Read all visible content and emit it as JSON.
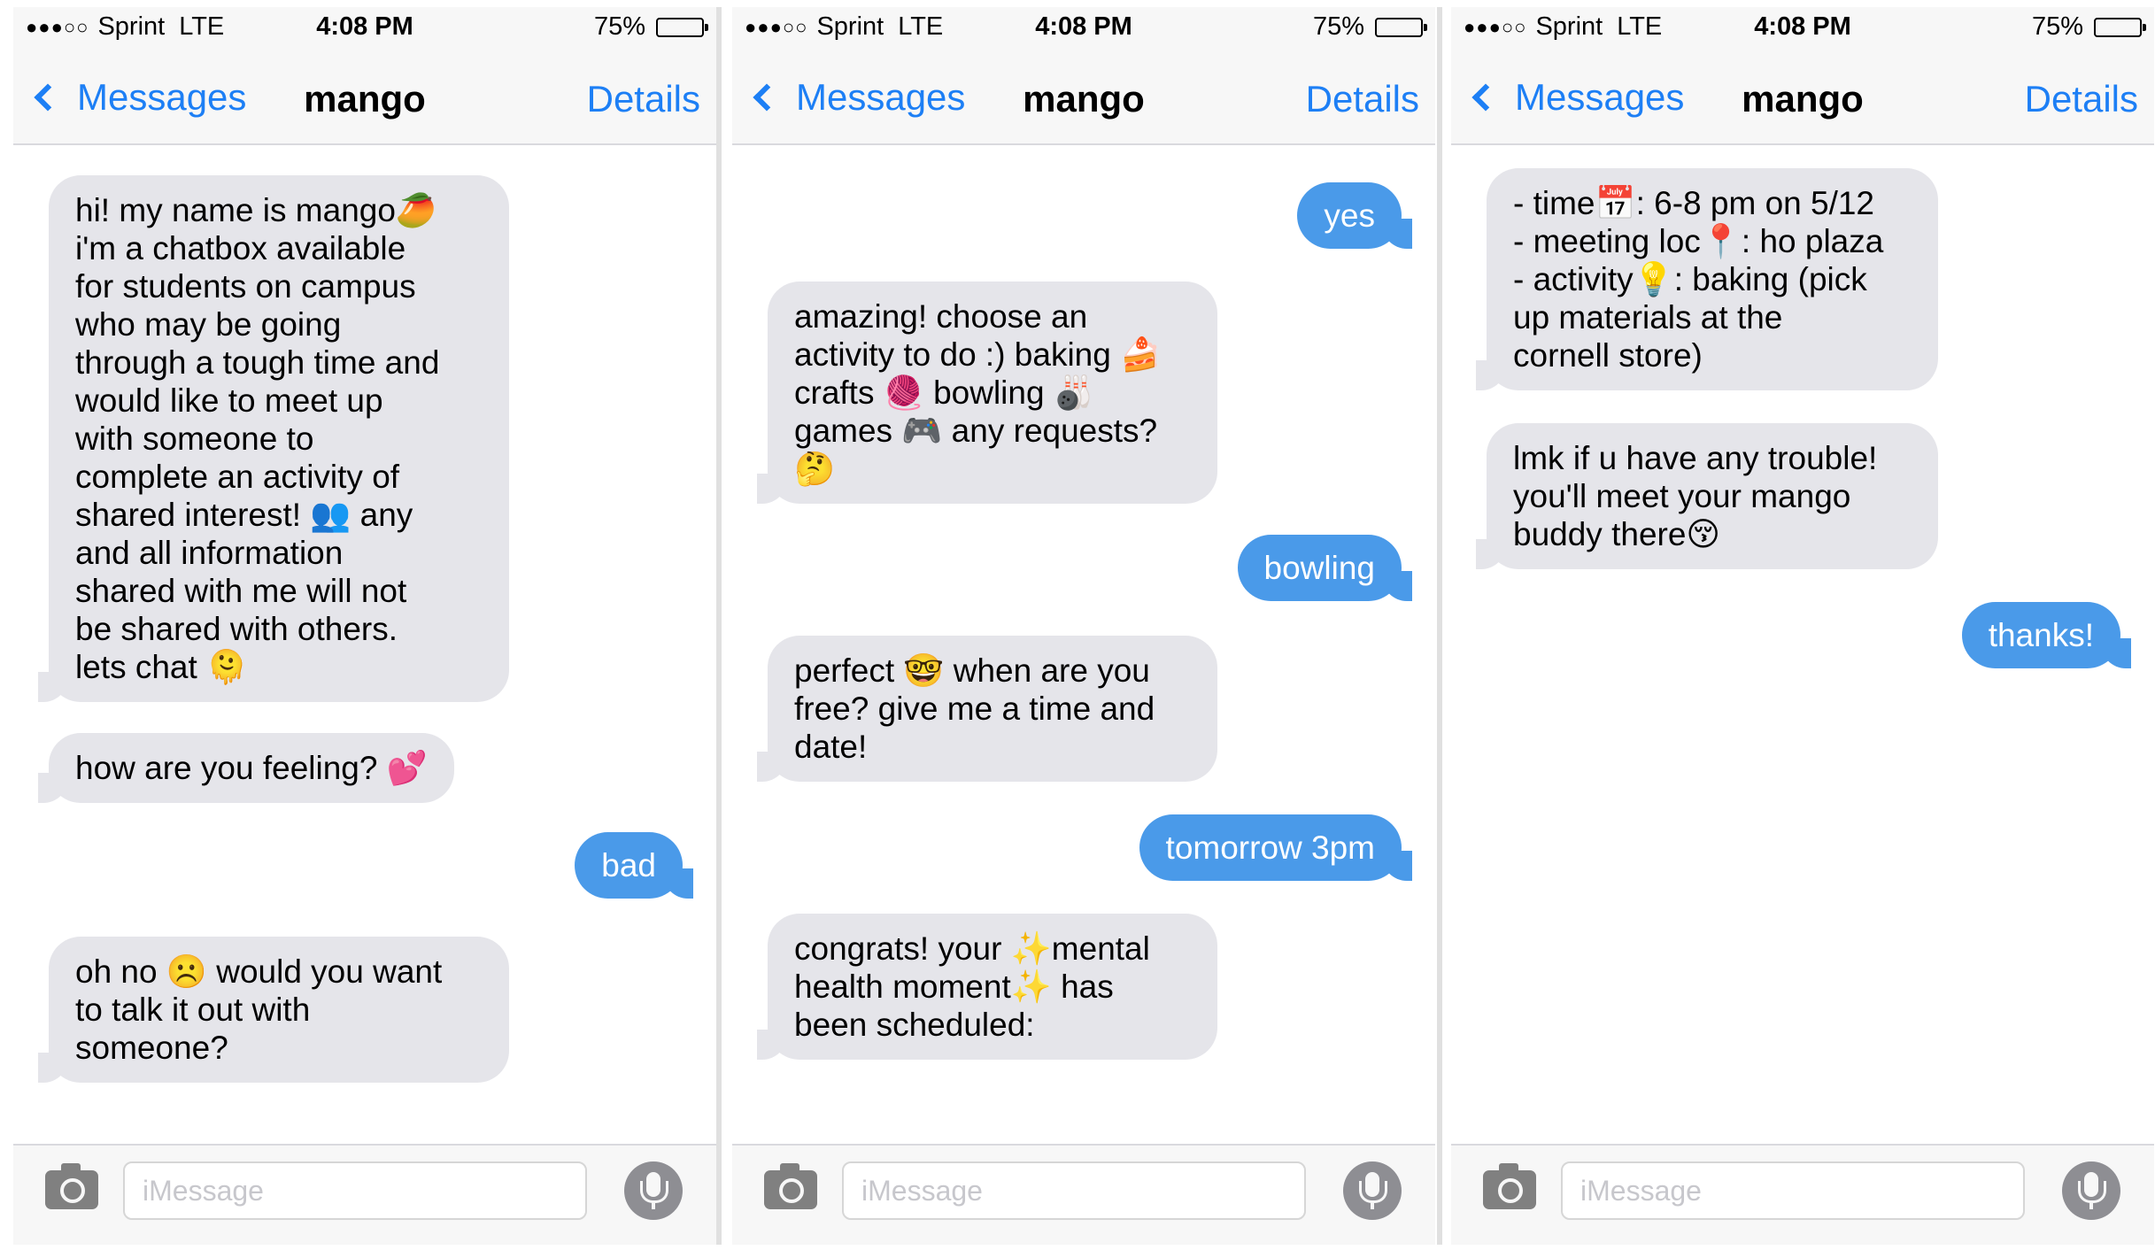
{
  "status": {
    "signal_dots": "●●●○○",
    "carrier": "Sprint",
    "network": "LTE",
    "time": "4:08 PM",
    "battery_text": "75%",
    "battery_level": 0.75
  },
  "nav": {
    "back_label": "Messages",
    "title": "mango",
    "details_label": "Details"
  },
  "input": {
    "placeholder": "iMessage"
  },
  "colors": {
    "accent": "#1d7ff5",
    "outgoing_bubble": "#4a9ae9",
    "incoming_bubble": "#e5e5ea"
  },
  "panels": [
    {
      "messages": [
        {
          "from": "bot",
          "text": "hi! my name is mango🥭\ni'm a chatbox available\nfor students on campus\nwho may be going\nthrough a tough time and\nwould like to meet up\nwith someone to\ncomplete an activity of\nshared interest! 👥 any\nand all information\nshared with me will not\nbe shared with others.\nlets chat 🫠"
        },
        {
          "from": "bot",
          "text": "how are you feeling? 💕"
        },
        {
          "from": "user",
          "text": "bad"
        },
        {
          "from": "bot",
          "text": "oh no ☹️ would you want\nto talk it out with\nsomeone?"
        }
      ]
    },
    {
      "messages": [
        {
          "from": "user",
          "text": "yes"
        },
        {
          "from": "bot",
          "text": "amazing! choose an\nactivity to do :) baking 🍰\ncrafts 🧶 bowling 🎳\ngames 🎮 any requests?\n🤔"
        },
        {
          "from": "user",
          "text": "bowling"
        },
        {
          "from": "bot",
          "text": "perfect 🤓 when are you\nfree? give me a time and\ndate!"
        },
        {
          "from": "user",
          "text": "tomorrow 3pm"
        },
        {
          "from": "bot",
          "text": "congrats! your ✨mental\nhealth moment✨ has\nbeen scheduled:"
        }
      ]
    },
    {
      "messages": [
        {
          "from": "bot",
          "text": "- time📅: 6-8 pm on 5/12\n- meeting loc📍: ho plaza\n- activity💡: baking (pick\nup materials at the\ncornell store)"
        },
        {
          "from": "bot",
          "text": "lmk if u have any trouble!\nyou'll meet your mango\nbuddy there😚"
        },
        {
          "from": "user",
          "text": "thanks!"
        }
      ]
    }
  ]
}
